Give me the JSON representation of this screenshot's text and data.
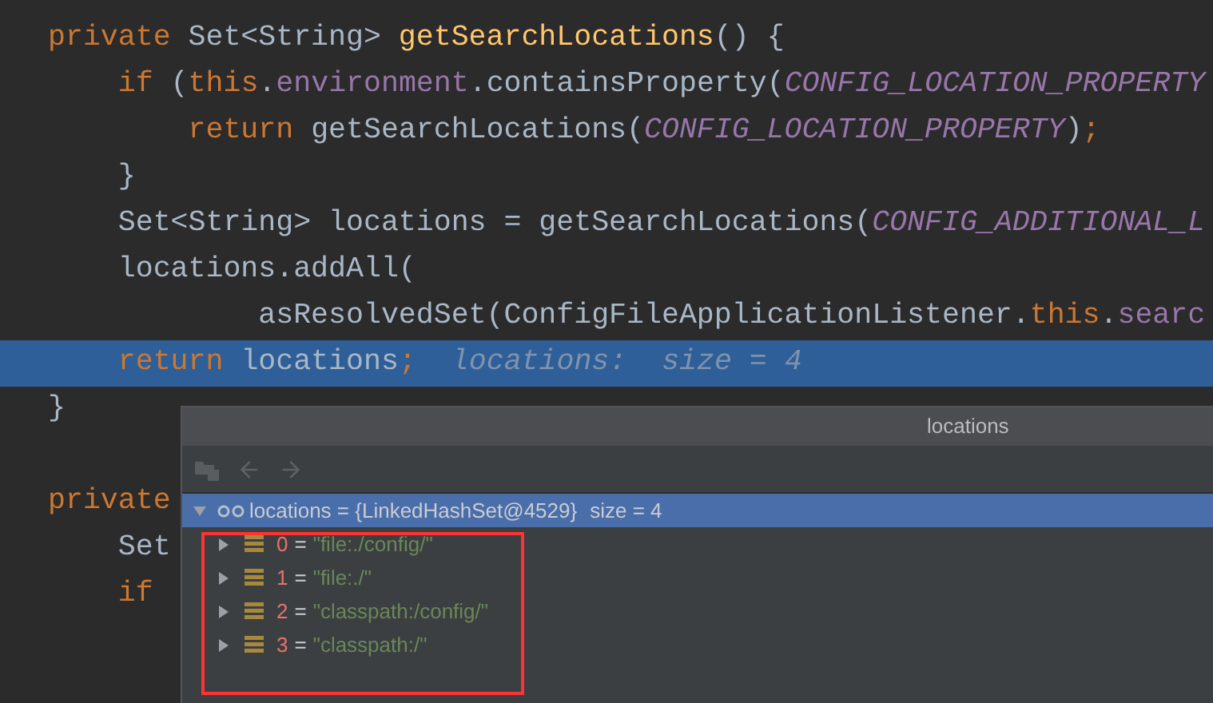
{
  "editor": {
    "lines": [
      {
        "selected": false,
        "tokens": [
          {
            "text": "private ",
            "kind": "keyword"
          },
          {
            "text": "Set<String> ",
            "kind": "plain"
          },
          {
            "text": "getSearchLocations",
            "kind": "method"
          },
          {
            "text": "() {",
            "kind": "plain"
          }
        ]
      },
      {
        "selected": false,
        "tokens": [
          {
            "text": "    if ",
            "kind": "keyword"
          },
          {
            "text": "(",
            "kind": "plain"
          },
          {
            "text": "this",
            "kind": "keyword"
          },
          {
            "text": ".",
            "kind": "plain"
          },
          {
            "text": "environment",
            "kind": "field"
          },
          {
            "text": ".containsProperty(",
            "kind": "plain"
          },
          {
            "text": "CONFIG_LOCATION_PROPERTY",
            "kind": "constant"
          }
        ]
      },
      {
        "selected": false,
        "tokens": [
          {
            "text": "        return ",
            "kind": "keyword"
          },
          {
            "text": "getSearchLocations(",
            "kind": "plain"
          },
          {
            "text": "CONFIG_LOCATION_PROPERTY",
            "kind": "constant"
          },
          {
            "text": ")",
            "kind": "plain"
          },
          {
            "text": ";",
            "kind": "keyword"
          }
        ]
      },
      {
        "selected": false,
        "tokens": [
          {
            "text": "    }",
            "kind": "plain"
          }
        ]
      },
      {
        "selected": false,
        "tokens": [
          {
            "text": "    Set<String> locations = getSearchLocations(",
            "kind": "plain"
          },
          {
            "text": "CONFIG_ADDITIONAL_L",
            "kind": "constant"
          }
        ]
      },
      {
        "selected": false,
        "tokens": [
          {
            "text": "    locations.addAll(",
            "kind": "plain"
          }
        ]
      },
      {
        "selected": false,
        "tokens": [
          {
            "text": "            asResolvedSet(ConfigFileApplicationListener.",
            "kind": "plain"
          },
          {
            "text": "this",
            "kind": "keyword"
          },
          {
            "text": ".",
            "kind": "plain"
          },
          {
            "text": "searc",
            "kind": "field"
          }
        ]
      },
      {
        "selected": true,
        "hint": "locations:  size = 4",
        "tokens": [
          {
            "text": "    return ",
            "kind": "keyword"
          },
          {
            "text": "locations",
            "kind": "plain"
          },
          {
            "text": ";",
            "kind": "keyword"
          }
        ]
      },
      {
        "selected": false,
        "tokens": [
          {
            "text": "}",
            "kind": "plain"
          }
        ]
      },
      {
        "selected": false
      },
      {
        "selected": false,
        "tokens": [
          {
            "text": "private",
            "kind": "keyword"
          }
        ]
      },
      {
        "selected": false,
        "tokens": [
          {
            "text": "    Set",
            "kind": "plain"
          }
        ]
      },
      {
        "selected": false,
        "tokens": [
          {
            "text": "    if",
            "kind": "keyword"
          }
        ]
      }
    ]
  },
  "popup": {
    "title": "locations",
    "root": {
      "label": "locations = {LinkedHashSet@4529}",
      "extra": "size = 4",
      "expanded": true,
      "selected": true,
      "children": [
        {
          "index": "0",
          "op": "=",
          "value": "\"file:./config/\"",
          "expanded": false
        },
        {
          "index": "1",
          "op": "=",
          "value": "\"file:./\"",
          "expanded": false
        },
        {
          "index": "2",
          "op": "=",
          "value": "\"classpath:/config/\"",
          "expanded": false
        },
        {
          "index": "3",
          "op": "=",
          "value": "\"classpath:/\"",
          "expanded": false
        }
      ]
    },
    "annotation": {
      "kind": "rectangle"
    }
  }
}
